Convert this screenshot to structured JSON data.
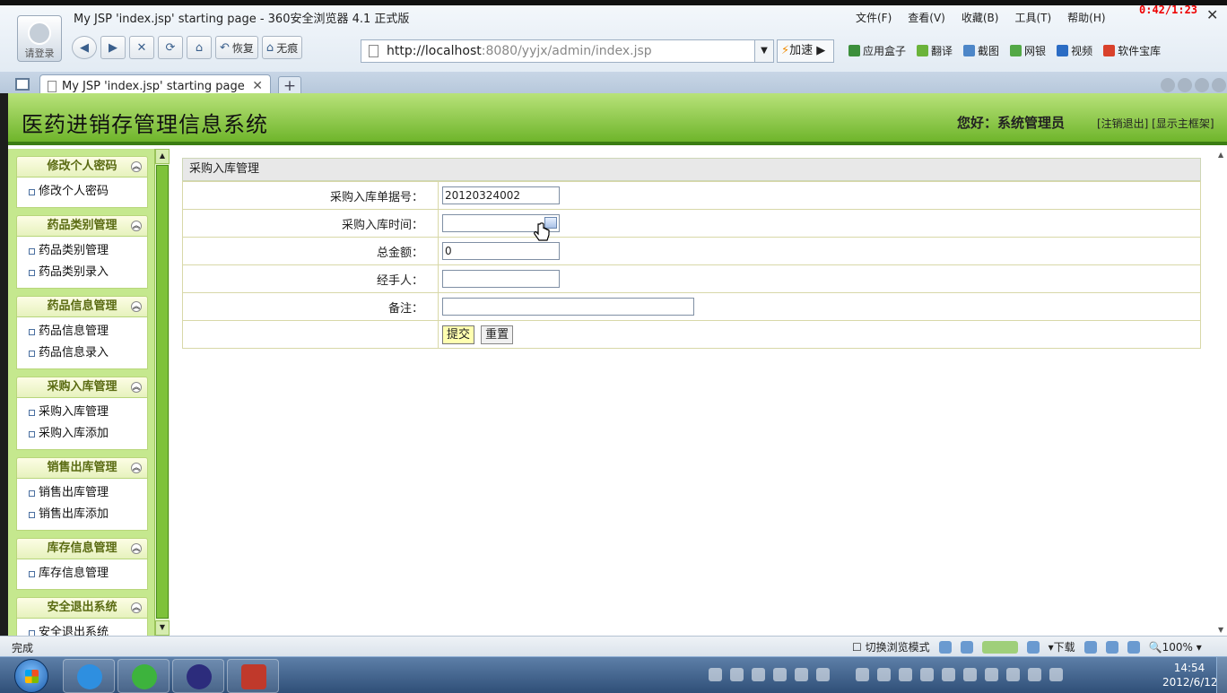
{
  "browser": {
    "window_title": "My JSP 'index.jsp' starting page - 360安全浏览器 4.1 正式版",
    "avatar_label": "请登录",
    "menu": [
      "文件(F)",
      "查看(V)",
      "收藏(B)",
      "工具(T)",
      "帮助(H)"
    ],
    "timer": "0:42/1:23",
    "nav": {
      "restore": "恢复",
      "incognito": "无痕"
    },
    "address": {
      "host": "http://localhost",
      "rest": ":8080/yyjx/admin/index.jsp"
    },
    "speed": "加速",
    "toolbar": [
      "应用盒子",
      "翻译",
      "截图",
      "网银",
      "视频",
      "软件宝库"
    ],
    "tab_title": "My JSP 'index.jsp' starting page",
    "new_tab": "+",
    "status_done": "完成",
    "status_right": {
      "compat": "切换浏览模式",
      "download": "下载",
      "zoom": "100%"
    }
  },
  "app": {
    "title": "医药进销存管理信息系统",
    "greeting": "您好：系统管理员",
    "links": "[注销退出] [显示主框架]"
  },
  "sidebar": {
    "groups": [
      {
        "title": "修改个人密码",
        "items": [
          "修改个人密码"
        ]
      },
      {
        "title": "药品类别管理",
        "items": [
          "药品类别管理",
          "药品类别录入"
        ]
      },
      {
        "title": "药品信息管理",
        "items": [
          "药品信息管理",
          "药品信息录入"
        ]
      },
      {
        "title": "采购入库管理",
        "items": [
          "采购入库管理",
          "采购入库添加"
        ]
      },
      {
        "title": "销售出库管理",
        "items": [
          "销售出库管理",
          "销售出库添加"
        ]
      },
      {
        "title": "库存信息管理",
        "items": [
          "库存信息管理"
        ]
      },
      {
        "title": "安全退出系统",
        "items": [
          "安全退出系统"
        ]
      }
    ]
  },
  "form": {
    "panel_title": "采购入库管理",
    "fields": [
      {
        "label": "采购入库单据号：",
        "value": "20120324002"
      },
      {
        "label": "采购入库时间：",
        "value": ""
      },
      {
        "label": "总金额：",
        "value": "0"
      },
      {
        "label": "经手人：",
        "value": ""
      },
      {
        "label": "备注：",
        "value": ""
      }
    ],
    "submit_label": "提交",
    "reset_label": "重置"
  },
  "taskbar": {
    "time": "14:54",
    "date": "2012/6/12"
  }
}
